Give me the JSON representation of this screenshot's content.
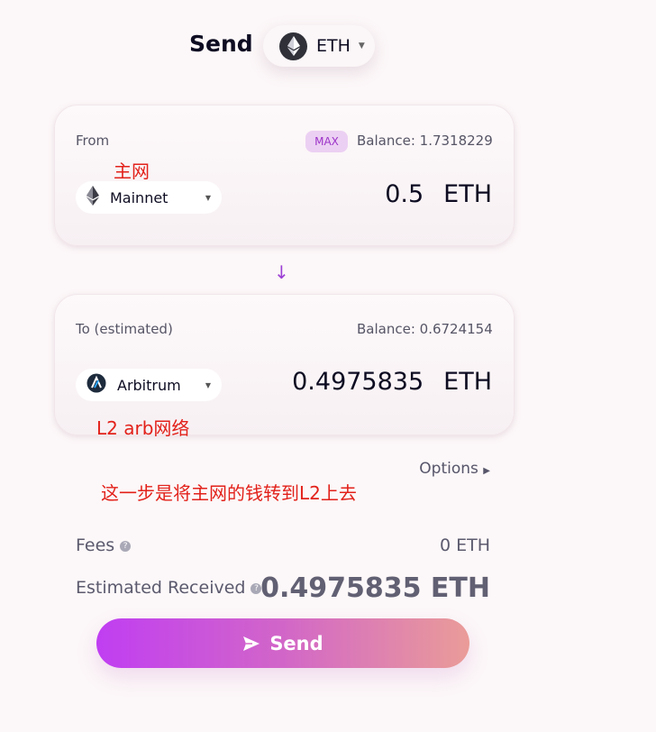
{
  "header": {
    "title": "Send",
    "token": "ETH"
  },
  "from_card": {
    "label": "From",
    "max_label": "MAX",
    "balance": "Balance: 1.7318229",
    "network": "Mainnet",
    "amount": "0.5",
    "unit": "ETH"
  },
  "to_card": {
    "label": "To (estimated)",
    "balance": "Balance: 0.6724154",
    "network": "Arbitrum",
    "amount": "0.4975835",
    "unit": "ETH"
  },
  "annotations": {
    "mainnet_note": "主网",
    "l2_note": "L2 arb网络",
    "step_note": "这一步是将主网的钱转到L2上去"
  },
  "options_label": "Options",
  "summary": {
    "fees_label": "Fees",
    "fees_value": "0 ETH",
    "received_label": "Estimated Received",
    "received_value": "0.4975835 ETH"
  },
  "send_button": "Send",
  "colors": {
    "accent_start": "#c03ef2",
    "accent_end": "#ea9c98",
    "annotation_red": "#e2211a"
  }
}
